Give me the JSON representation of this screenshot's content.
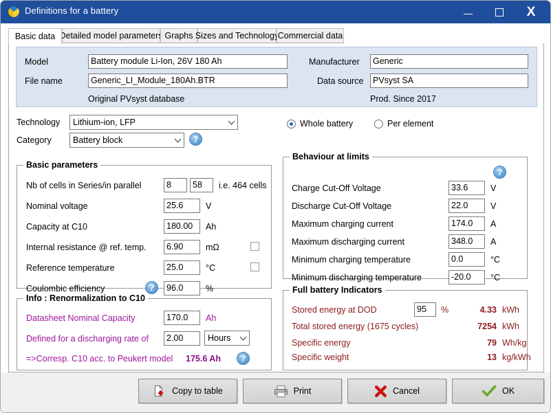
{
  "window": {
    "title": "Definitions for a battery",
    "icon": "pvsyst-logo-icon",
    "minimize_label": "Minimize",
    "maximize_label": "Maximize",
    "close_label": "X"
  },
  "tabs": [
    {
      "label": "Basic data",
      "active": true
    },
    {
      "label": "Detailed model parameters",
      "active": false
    },
    {
      "label": "Graphs",
      "active": false
    },
    {
      "label": "Sizes and Technology",
      "active": false
    },
    {
      "label": "Commercial data",
      "active": false
    }
  ],
  "header": {
    "model_label": "Model",
    "model_value": "Battery module Li-Ion, 26V 180 Ah",
    "filename_label": "File name",
    "filename_value": "Generic_LI_Module_180Ah.BTR",
    "database_note": "Original PVsyst database",
    "manufacturer_label": "Manufacturer",
    "manufacturer_value": "Generic",
    "datasource_label": "Data source",
    "datasource_value": "PVsyst SA",
    "prod_note": "Prod. Since 2017"
  },
  "selectors": {
    "technology_label": "Technology",
    "technology_value": "Lithium-ion, LFP",
    "category_label": "Category",
    "category_value": "Battery block",
    "category_help": "?",
    "scope_whole_label": "Whole battery",
    "scope_per_element_label": "Per element",
    "scope_selected": "Whole battery"
  },
  "basic_parameters": {
    "title": "Basic parameters",
    "rows": [
      {
        "label": "Nb of cells in Series/in parallel",
        "value": "8",
        "value2": "58",
        "unit": "i.e. 464 cells"
      },
      {
        "label": "Nominal voltage",
        "value": "25.6",
        "unit": "V"
      },
      {
        "label": "Capacity at C10",
        "value": "180.00",
        "unit": "Ah"
      },
      {
        "label": "Internal resistance @ ref. temp.",
        "value": "6.90",
        "unit": "mΩ",
        "checkbox": false
      },
      {
        "label": "Reference temperature",
        "value": "25.0",
        "unit": "°C",
        "checkbox": false
      },
      {
        "label": "Coulombic efficiency",
        "value": "96.0",
        "unit": "%",
        "help": "?"
      }
    ]
  },
  "renormalization": {
    "title": "Info : Renormalization to C10",
    "datasheet_label": "Datasheet Nominal Capacity",
    "datasheet_value": "170.0",
    "datasheet_unit": "Ah",
    "rate_label": "Defined for a discharging rate of",
    "rate_value": "2.00",
    "rate_unit_value": "Hours",
    "result_label": "=>Corresp. C10 acc. to Peukert model",
    "result_value": "175.6 Ah",
    "help": "?"
  },
  "behaviour": {
    "title": "Behaviour at limits",
    "help": "?",
    "rows": [
      {
        "label": "Charge Cut-Off Voltage",
        "value": "33.6",
        "unit": "V"
      },
      {
        "label": "Discharge Cut-Off Voltage",
        "value": "22.0",
        "unit": "V"
      },
      {
        "label": "Maximum charging current",
        "value": "174.0",
        "unit": "A"
      },
      {
        "label": "Maximum discharging current",
        "value": "348.0",
        "unit": "A"
      },
      {
        "label": "Minimum charging temperature",
        "value": "0.0",
        "unit": "°C"
      },
      {
        "label": "Minimum discharging temperature",
        "value": "-20.0",
        "unit": "°C"
      }
    ]
  },
  "indicators": {
    "title": "Full battery Indicators",
    "dod_label": "Stored energy at DOD",
    "dod_value": "95",
    "dod_percent": "%",
    "dod_result": "4.33",
    "dod_unit": "kWh",
    "total_label": "Total stored energy (1675 cycles)",
    "total_value": "7254",
    "total_unit": "kWh",
    "spec_energy_label": "Specific energy",
    "spec_energy_value": "79",
    "spec_energy_unit": "Wh/kg",
    "spec_weight_label": "Specific weight",
    "spec_weight_value": "13",
    "spec_weight_unit": "kg/kWh"
  },
  "buttons": {
    "copy_to_table": "Copy to table",
    "print": "Print",
    "cancel": "Cancel",
    "ok": "OK"
  },
  "colors": {
    "titlebar": "#1f4e9c",
    "header_panel": "#dbe5f1",
    "magenta": "#a0159e",
    "dark_red": "#8c1a1a",
    "accent_blue": "#1a6fc4"
  }
}
